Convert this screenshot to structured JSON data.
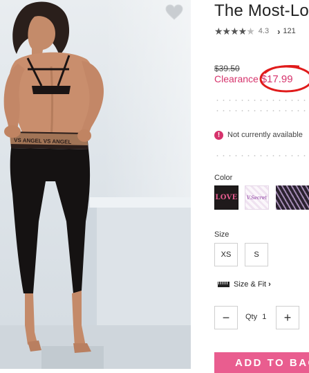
{
  "product": {
    "title": "The Most-Lo",
    "rating_value": "4.3",
    "review_count": "121",
    "stars_full": 4,
    "stars_partial": 0.3
  },
  "pricing": {
    "original_price": "$39.50",
    "sale_label": "Clearance",
    "sale_price": "$17.99",
    "sale_color": "#d6336c",
    "highlight_circle_color": "#e01b1b"
  },
  "availability": {
    "notice_text": "Not currently available"
  },
  "color": {
    "label": "Color",
    "swatches": [
      {
        "name": "black-love",
        "text": "LOVE"
      },
      {
        "name": "lavender-vsecret",
        "text": "V.Secret"
      },
      {
        "name": "purple-print",
        "text": ""
      }
    ]
  },
  "size": {
    "label": "Size",
    "options": [
      "XS",
      "S"
    ],
    "size_fit_link": "Size & Fit"
  },
  "quantity": {
    "minus": "−",
    "label": "Qty",
    "value": "1",
    "plus": "+"
  },
  "cart": {
    "add_to_bag_label": "ADD TO BAG",
    "button_color": "#e95d8f"
  },
  "icons": {
    "favorite": "heart-icon",
    "alert": "alert-icon",
    "ruler": "ruler-icon"
  }
}
